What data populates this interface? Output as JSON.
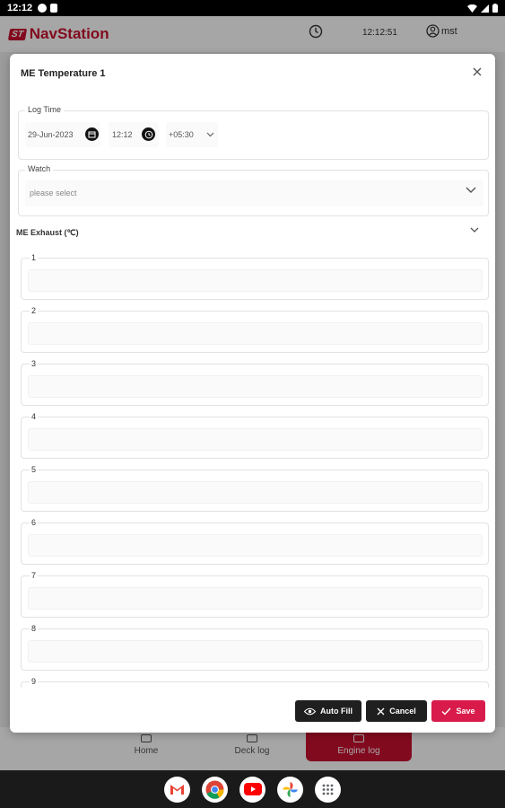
{
  "status_bar": {
    "time": "12:12"
  },
  "app": {
    "name": "NavStation",
    "logo_mark": "ST",
    "clock_time": "12:12:51",
    "user": "mst",
    "nav": [
      {
        "label": "Home",
        "active": false
      },
      {
        "label": "Deck log",
        "active": false
      },
      {
        "label": "Engine log",
        "active": true
      }
    ]
  },
  "modal": {
    "title": "ME Temperature 1",
    "log_time": {
      "label": "Log Time",
      "date": "29-Jun-2023",
      "time": "12:12",
      "tz": "+05:30"
    },
    "watch": {
      "label": "Watch",
      "placeholder": "please select"
    },
    "section": {
      "title": "ME Exhaust (℃)"
    },
    "fields": [
      {
        "label": "1",
        "value": ""
      },
      {
        "label": "2",
        "value": ""
      },
      {
        "label": "3",
        "value": ""
      },
      {
        "label": "4",
        "value": ""
      },
      {
        "label": "5",
        "value": ""
      },
      {
        "label": "6",
        "value": ""
      },
      {
        "label": "7",
        "value": ""
      },
      {
        "label": "8",
        "value": ""
      },
      {
        "label": "9",
        "value": ""
      }
    ],
    "actions": {
      "autofill": "Auto Fill",
      "cancel": "Cancel",
      "save": "Save"
    }
  },
  "dock": [
    {
      "icon": "gmail-icon"
    },
    {
      "icon": "chrome-icon"
    },
    {
      "icon": "youtube-icon"
    },
    {
      "icon": "photos-icon"
    },
    {
      "icon": "apps-grid-icon"
    }
  ],
  "colors": {
    "brand": "#c8102e",
    "save": "#d81b4a"
  }
}
